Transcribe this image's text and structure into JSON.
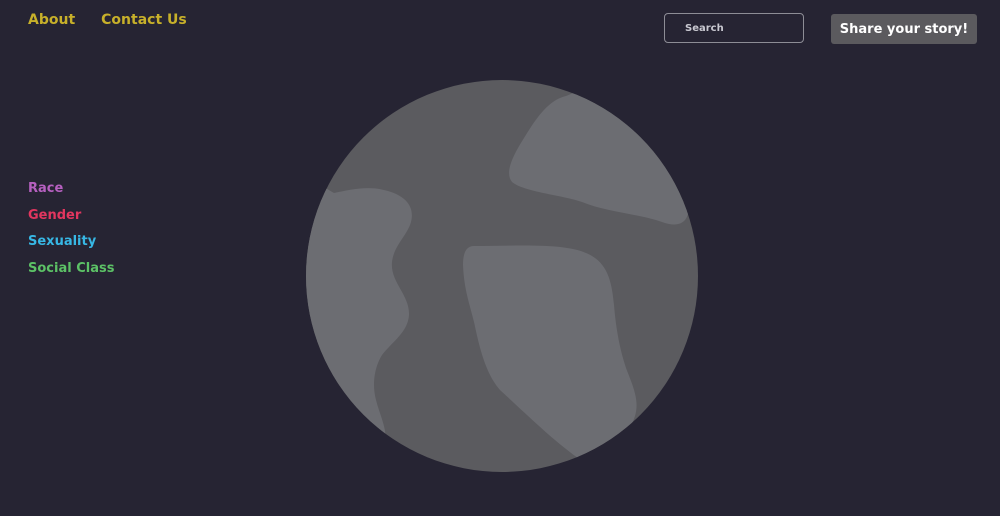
{
  "nav": {
    "about": "About",
    "contact": "Contact Us"
  },
  "search": {
    "placeholder": "Search"
  },
  "share_button": {
    "label": "Share your story!"
  },
  "categories": [
    {
      "label": "Race",
      "color": "#b660c0"
    },
    {
      "label": "Gender",
      "color": "#e2365f"
    },
    {
      "label": "Sexuality",
      "color": "#37b7e4"
    },
    {
      "label": "Social Class",
      "color": "#5cc166"
    }
  ],
  "colors": {
    "background": "#262433",
    "nav_link": "#c7b02a",
    "globe_ocean": "#5b5b5f",
    "globe_land": "#6c6d72"
  },
  "globe": {
    "icon": "globe-icon"
  }
}
